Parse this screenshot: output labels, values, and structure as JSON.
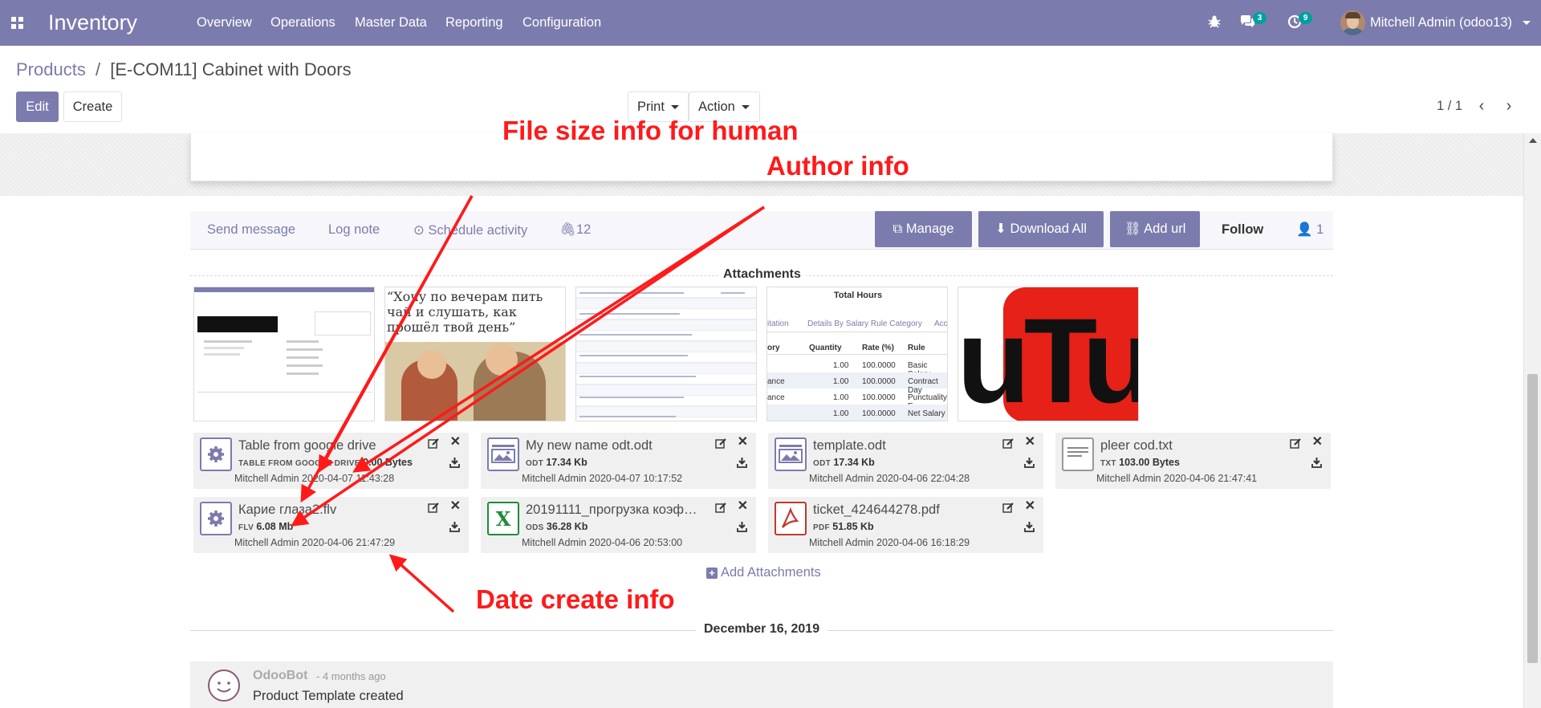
{
  "navbar": {
    "app_title": "Inventory",
    "menu": [
      "Overview",
      "Operations",
      "Master Data",
      "Reporting",
      "Configuration"
    ],
    "chat_count": "3",
    "activity_count": "9",
    "user": "Mitchell Admin (odoo13)"
  },
  "breadcrumb": {
    "parent": "Products",
    "separator": "/",
    "current": "[E-COM11] Cabinet with Doors"
  },
  "control": {
    "edit": "Edit",
    "create": "Create",
    "print": "Print",
    "action": "Action",
    "pager": "1 / 1"
  },
  "chatter": {
    "send_message": "Send message",
    "log_note": "Log note",
    "schedule_activity": "Schedule activity",
    "attachment_count": "12",
    "manage": "Manage",
    "download_all": "Download All",
    "add_url": "Add url",
    "follow": "Follow",
    "followers": "1"
  },
  "attachments": {
    "title": "Attachments",
    "thumbnails": [
      {
        "alt": "form screenshot",
        "text": ""
      },
      {
        "alt": "illustration",
        "text": "“Хочу по вечерам пить чай и слушать, как прошёл твой день”"
      },
      {
        "alt": "salary slips list",
        "text": ""
      },
      {
        "alt": "salary rule table",
        "text": "Total Hours",
        "tab1": "itation",
        "tab2": "Details By Salary Rule Category",
        "tab3": "Acc",
        "col1": "ory",
        "col2": "Quantity",
        "col3": "Rate (%)",
        "col4": "Rule",
        "rows": [
          [
            "",
            "1.00",
            "100.0000",
            "Basic Salary"
          ],
          [
            "ance",
            "1.00",
            "100.0000",
            "Contract Day"
          ],
          [
            "ance",
            "1.00",
            "100.0000",
            "Punctuality E"
          ],
          [
            "",
            "1.00",
            "100.0000",
            "Net Salary"
          ]
        ]
      },
      {
        "alt": "youtube logo",
        "text": "uTub"
      }
    ],
    "files": [
      {
        "name": "Table from google drive",
        "ext": "TABLE FROM GOOGLE DRIVE",
        "size": "0.00 Bytes",
        "info": "Mitchell Admin 2020-04-07 11:43:28",
        "icon": "gear-icon"
      },
      {
        "name": "My new name odt.odt",
        "ext": "ODT",
        "size": "17.34 Kb",
        "info": "Mitchell Admin 2020-04-07 10:17:52",
        "icon": "image-doc-icon"
      },
      {
        "name": "template.odt",
        "ext": "ODT",
        "size": "17.34 Kb",
        "info": "Mitchell Admin 2020-04-06 22:04:28",
        "icon": "image-doc-icon"
      },
      {
        "name": "pleer cod.txt",
        "ext": "TXT",
        "size": "103.00 Bytes",
        "info": "Mitchell Admin 2020-04-06 21:47:41",
        "icon": "text-doc-icon"
      },
      {
        "name": "Карие глаза2.flv",
        "ext": "FLV",
        "size": "6.08 Mb",
        "info": "Mitchell Admin 2020-04-06 21:47:29",
        "icon": "gear-icon"
      },
      {
        "name": "20191111_прогрузка коэфф...",
        "ext": "ODS",
        "size": "36.28 Kb",
        "info": "Mitchell Admin 2020-04-06 20:53:00",
        "icon": "spreadsheet-icon"
      },
      {
        "name": "ticket_424644278.pdf",
        "ext": "PDF",
        "size": "51.85 Kb",
        "info": "Mitchell Admin 2020-04-06 16:18:29",
        "icon": "pdf-icon"
      }
    ],
    "add_label": "Add Attachments"
  },
  "thread": {
    "date_separator": "December 16, 2019",
    "author": "OdooBot",
    "time": "- 4 months ago",
    "body": "Product Template created"
  },
  "annotations": {
    "file_size": "File size info for human",
    "author": "Author info",
    "date_create": "Date create info"
  },
  "colors": {
    "brand": "#7c7bad",
    "annotation": "#ff1a1a",
    "badge": "#00a09d"
  }
}
